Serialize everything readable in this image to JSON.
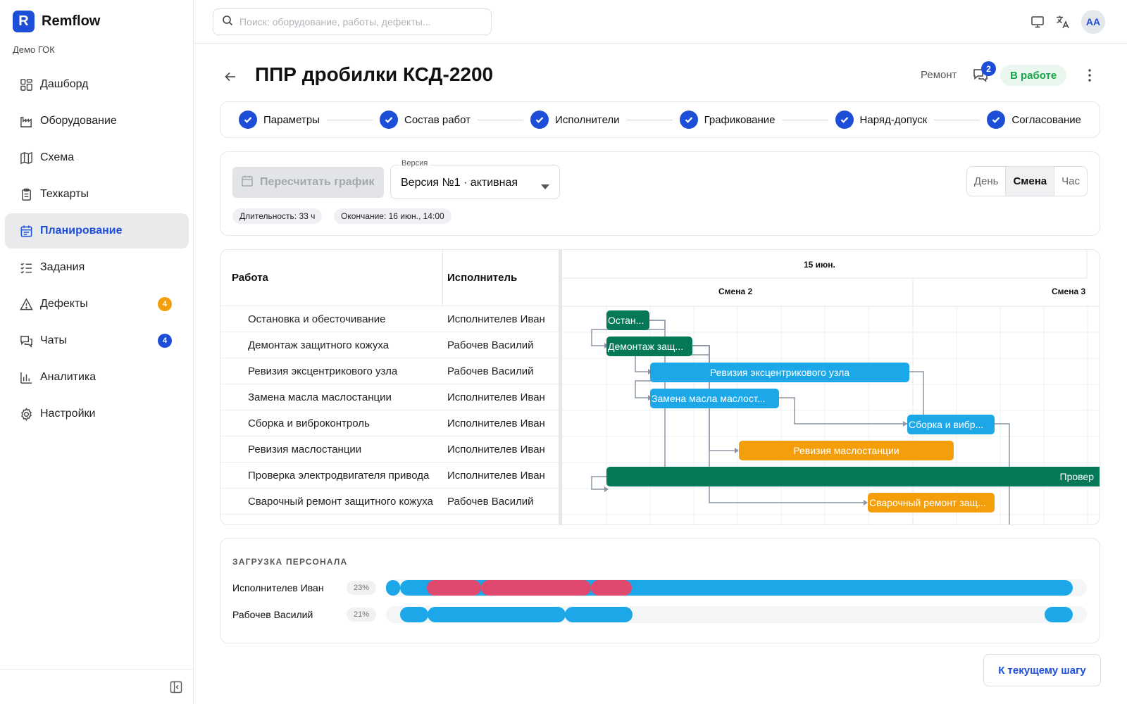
{
  "sidebar": {
    "brand": "Remflow",
    "org": "Демо ГОК",
    "items": [
      {
        "label": "Дашборд",
        "icon": "dashboard-icon"
      },
      {
        "label": "Оборудование",
        "icon": "factory-icon"
      },
      {
        "label": "Схема",
        "icon": "map-icon"
      },
      {
        "label": "Техкарты",
        "icon": "clipboard-icon"
      },
      {
        "label": "Планирование",
        "icon": "calendar-icon",
        "active": true
      },
      {
        "label": "Задания",
        "icon": "checklist-icon"
      },
      {
        "label": "Дефекты",
        "icon": "warning-icon",
        "badge": "4",
        "badge_color": "#f59e0b"
      },
      {
        "label": "Чаты",
        "icon": "chat-icon",
        "badge": "4",
        "badge_color": "#1d4ed8"
      },
      {
        "label": "Аналитика",
        "icon": "bar-chart-icon"
      },
      {
        "label": "Настройки",
        "icon": "gear-icon"
      }
    ]
  },
  "search": {
    "placeholder": "Поиск: оборудование, работы, дефекты..."
  },
  "user": {
    "initials": "AA"
  },
  "page": {
    "title": "ППР дробилки КСД-2200",
    "type": "Ремонт",
    "chat_count": "2",
    "status": "В работе"
  },
  "steps": [
    "Параметры",
    "Состав работ",
    "Исполнители",
    "Графикование",
    "Наряд-допуск",
    "Согласование"
  ],
  "controls": {
    "recalc": "Пересчитать график",
    "version_label": "Версия",
    "version_value": "Версия №1 · активная",
    "duration": "Длительность: 33 ч",
    "end": "Окончание: 16 июн., 14:00",
    "scales": [
      "День",
      "Смена",
      "Час"
    ],
    "active_scale": "Смена"
  },
  "gantt": {
    "col_work": "Работа",
    "col_exec": "Исполнитель",
    "day": "15 июн.",
    "shifts": [
      "Смена 2",
      "Смена 3"
    ],
    "rows": [
      {
        "work": "Остановка и обесточивание",
        "exec": "Исполнителев Иван",
        "bar": "Остан...",
        "color": "#047857"
      },
      {
        "work": "Демонтаж защитного кожуха",
        "exec": "Рабочев Василий",
        "bar": "Демонтаж защ...",
        "color": "#047857"
      },
      {
        "work": "Ревизия эксцентрикового узла",
        "exec": "Рабочев Василий",
        "bar": "Ревизия эксцентрикового узла",
        "color": "#0ea5e9"
      },
      {
        "work": "Замена масла маслостанции",
        "exec": "Исполнителев Иван",
        "bar": "Замена масла маслост...",
        "color": "#0ea5e9"
      },
      {
        "work": "Сборка и виброконтроль",
        "exec": "Исполнителев Иван",
        "bar": "Сборка и вибр...",
        "color": "#0ea5e9"
      },
      {
        "work": "Ревизия маслостанции",
        "exec": "Исполнителев Иван",
        "bar": "Ревизия маслостанции",
        "color": "#f59e0b"
      },
      {
        "work": "Проверка электродвигателя привода",
        "exec": "Исполнителев Иван",
        "bar": "Провер",
        "color": "#047857"
      },
      {
        "work": "Сварочный ремонт защитного кожуха",
        "exec": "Рабочев Василий",
        "bar": "Сварочный ремонт защ...",
        "color": "#f59e0b"
      }
    ]
  },
  "workload": {
    "title": "ЗАГРУЗКА ПЕРСОНАЛА",
    "people": [
      {
        "name": "Исполнителев Иван",
        "pct": "23%"
      },
      {
        "name": "Рабочев Василий",
        "pct": "21%"
      }
    ]
  },
  "goto_current": "К текущему шагу",
  "colors": {
    "accent": "#1d4ed8",
    "success": "#16a34a",
    "overload": "#e0486d",
    "load": "#1ba7e8"
  }
}
